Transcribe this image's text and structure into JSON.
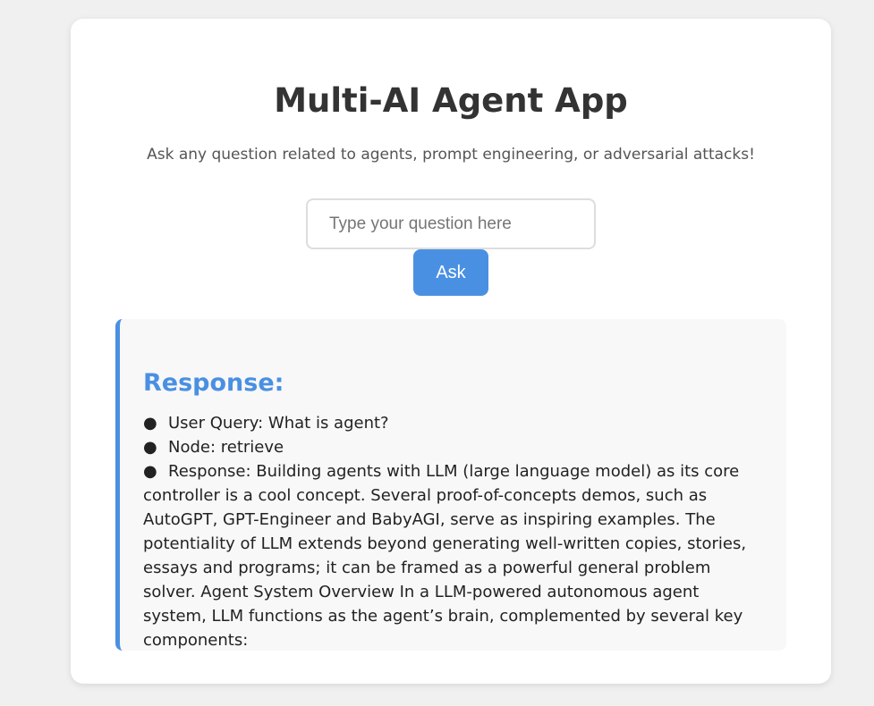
{
  "app": {
    "title": "Multi-AI Agent App",
    "subtitle": "Ask any question related to agents, prompt engineering, or adversarial attacks!"
  },
  "form": {
    "input_value": "",
    "input_placeholder": "Type your question here",
    "ask_label": "Ask"
  },
  "response": {
    "heading": "Response:",
    "items": [
      {
        "label": "User Query: What is agent?"
      },
      {
        "label": "Node: retrieve"
      },
      {
        "label": "Response: Building agents with LLM (large language model) as its core controller is a cool concept. Several proof-of-concepts demos, such as AutoGPT, GPT-Engineer and BabyAGI, serve as inspiring examples. The potentiality of LLM extends beyond generating well-written copies, stories, essays and programs; it can be framed as a powerful general problem solver. Agent System Overview In a LLM-powered autonomous agent system, LLM functions as the agent’s brain, complemented by several key components:"
      }
    ]
  },
  "colors": {
    "accent": "#4a90e2",
    "background": "#f0f0f0",
    "card": "#ffffff",
    "response_background": "#f8f8f8"
  }
}
